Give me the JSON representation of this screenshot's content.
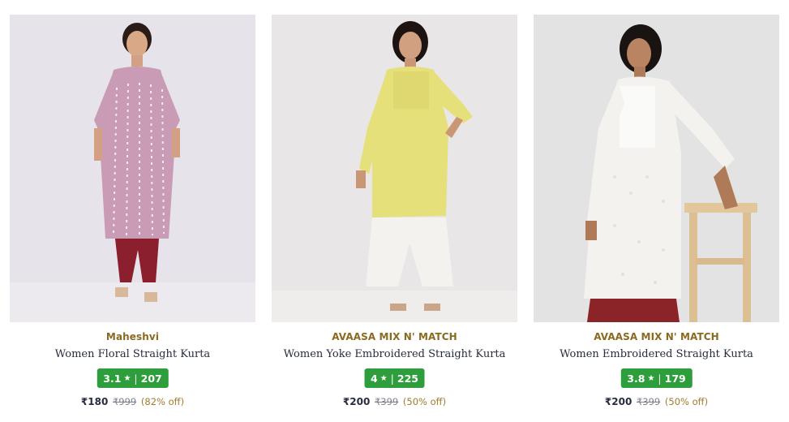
{
  "products": [
    {
      "brand": "Maheshvi",
      "title": "Women Floral Straight Kurta",
      "rating": "3.1",
      "rating_count": "207",
      "price": "₹180",
      "mrp": "₹999",
      "discount": "(82% off)"
    },
    {
      "brand": "AVAASA MIX N' MATCH",
      "title": "Women Yoke Embroidered Straight Kurta",
      "rating": "4",
      "rating_count": "225",
      "price": "₹200",
      "mrp": "₹399",
      "discount": "(50% off)"
    },
    {
      "brand": "AVAASA MIX N' MATCH",
      "title": "Women Embroidered Straight Kurta",
      "rating": "3.8",
      "rating_count": "179",
      "price": "₹200",
      "mrp": "₹399",
      "discount": "(50% off)"
    }
  ],
  "colors": {
    "rating_badge": "#2e9e3c",
    "brand_text": "#8a6a1f",
    "discount_text": "#a07b2e"
  },
  "icons": {
    "rating": "star-icon"
  }
}
